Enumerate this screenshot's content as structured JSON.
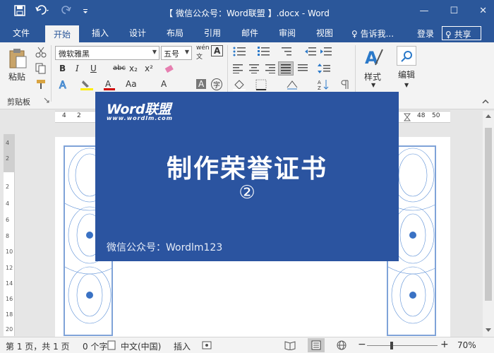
{
  "window": {
    "title": "【 微信公众号：Word联盟 】.docx - Word",
    "minimize_icon": "minimize-icon",
    "maximize_icon": "maximize-icon",
    "close_icon": "close-icon"
  },
  "qat": {
    "save": "save-icon",
    "undo": "undo-icon",
    "redo": "redo-icon",
    "more": "customize-icon"
  },
  "tabs": [
    "文件",
    "开始",
    "插入",
    "设计",
    "布局",
    "引用",
    "邮件",
    "审阅",
    "视图"
  ],
  "active_tab": "开始",
  "tellme": "♀ 告诉我...",
  "login": "登录",
  "share": "♀ 共享",
  "ribbon": {
    "clipboard": {
      "paste": "粘贴",
      "group": "剪贴板"
    },
    "font_name": "微软雅黑",
    "font_size": "五号",
    "wen": "wén",
    "wen_char": "文",
    "big_a": "A",
    "bold": "B",
    "italic": "I",
    "underline": "U",
    "strike": "abc",
    "sub": "x₂",
    "sup": "x²",
    "font_color_a": "A",
    "a_up": "A",
    "aa": "Aa",
    "a_char": "A",
    "zi": "字",
    "styles": "样式",
    "editing": "编辑"
  },
  "ruler": {
    "left_nums": [
      "4",
      "2"
    ],
    "right_nums": [
      "48",
      "50"
    ],
    "vertical": [
      "4",
      "2",
      "2",
      "4",
      "6",
      "8",
      "10",
      "12",
      "14",
      "16",
      "18",
      "20"
    ]
  },
  "card": {
    "logo": "Word联盟",
    "url": "www.wordlm.com",
    "headline": "制作荣誉证书",
    "number": "②",
    "wechat": "微信公众号：Wordlm123"
  },
  "status": {
    "page": "第 1 页，共 1 页",
    "words": "0 个字",
    "lang": "中文(中国)",
    "insert": "插入",
    "zoom": "70%"
  },
  "colors": {
    "accent": "#2b579a",
    "card": "#2b54a0"
  }
}
